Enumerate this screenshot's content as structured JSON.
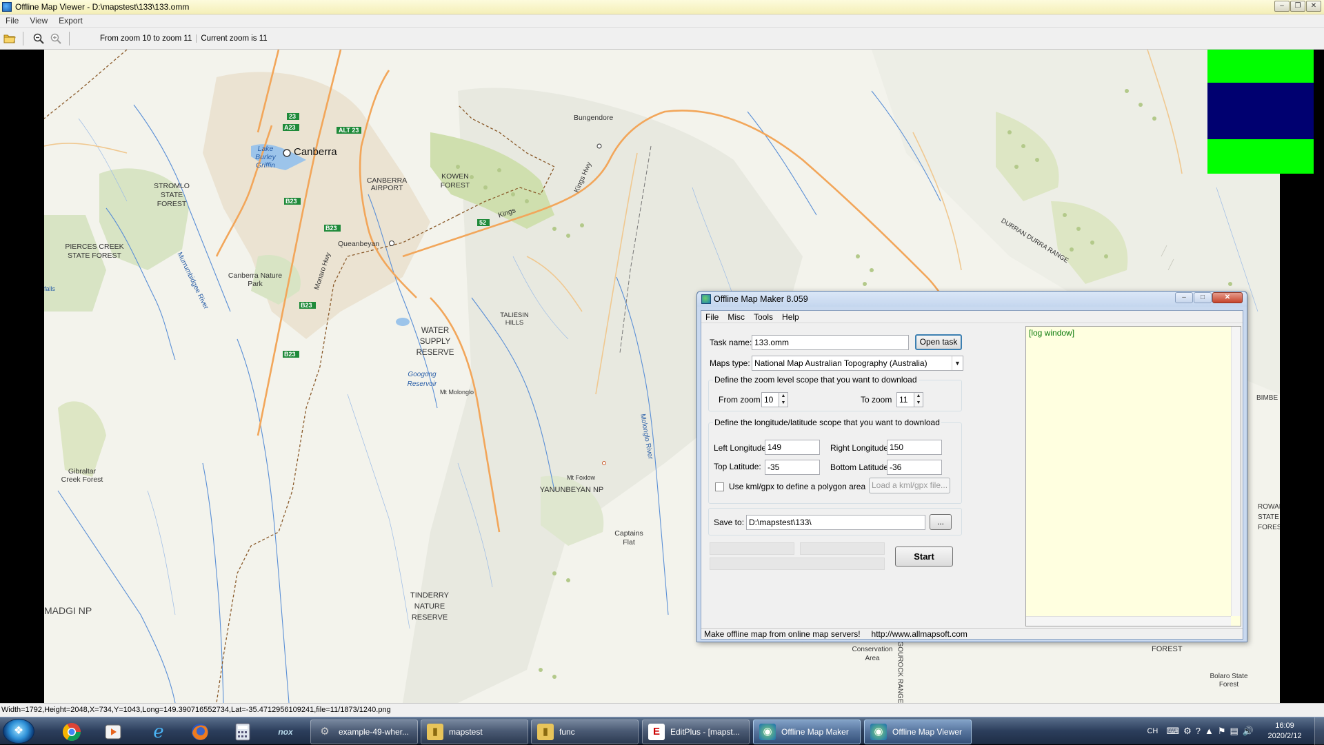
{
  "viewer": {
    "title": "Offline Map Viewer - D:\\mapstest\\133\\133.omm",
    "menu": [
      "File",
      "View",
      "Export"
    ],
    "toolbar": {
      "zoom_range": "From zoom 10 to zoom 11",
      "current_zoom": "Current zoom is 11"
    },
    "status": "Width=1792,Height=2048,X=734,Y=1043,Long=149.390716552734,Lat=-35.4712956109241,file=11/1873/1240.png"
  },
  "map": {
    "labels": [
      "Canberra",
      "CANBERRA AIRPORT",
      "Lake Burley Griffin",
      "STROMLO STATE FOREST",
      "PIERCES CREEK STATE FOREST",
      "Canberra Nature Park",
      "Queanbeyan",
      "Bungendore",
      "KOWEN FOREST",
      "Kings",
      "TALIESIN HILLS",
      "WATER SUPPLY RESERVE",
      "Googong Reservoir",
      "Mt Molonglo",
      "YANUNBEYAN NP",
      "Mt Foxlow",
      "Captains Flat",
      "TINDERRY NATURE RESERVE",
      "MADGI NP",
      "Gibraltar Creek Forest",
      "DURRAN DURRA RANGE",
      "Conservation Area",
      "FOREST",
      "Bolaro State Forest",
      "Monaro Hwy",
      "Kings Hwy",
      "Molonglo River",
      "Murrumbidgee River",
      "GOUROCK RANGE",
      "BIMBE",
      "ROWAN STATE FOREST",
      "falls"
    ],
    "road_shields": [
      "23",
      "A23",
      "ALT 23",
      "B23",
      "52"
    ],
    "colors": {
      "water": "#3b7fd4",
      "road_major": "#f2a65a",
      "road_minor": "#f0c890",
      "forest": "#d6e3bf",
      "park": "#ede3cf"
    }
  },
  "overview": {
    "colors": {
      "fill": "#00ff00",
      "band": "#000070"
    }
  },
  "dialog": {
    "title": "Offline Map Maker 8.059",
    "menu": [
      "File",
      "Misc",
      "Tools",
      "Help"
    ],
    "task_name_label": "Task name:",
    "task_name_value": "133.omm",
    "open_task_button": "Open task ...",
    "maps_type_label": "Maps type:",
    "maps_type_value": "National Map Australian Topography (Australia)",
    "zoom_group_label": "Define the zoom level scope that you want to download",
    "from_zoom_label": "From zoom",
    "from_zoom_value": "10",
    "to_zoom_label": "To zoom",
    "to_zoom_value": "11",
    "lonlat_group_label": "Define the longitude/latitude scope that you want to download",
    "left_lon_label": "Left Longitude:",
    "left_lon_value": "149",
    "right_lon_label": "Right Longitude:",
    "right_lon_value": "150",
    "top_lat_label": "Top Latitude:",
    "top_lat_value": "-35",
    "bottom_lat_label": "Bottom Latitude:",
    "bottom_lat_value": "-36",
    "kml_checkbox_label": "Use kml/gpx to define a polygon area",
    "kml_checked": false,
    "load_kml_button": "Load a kml/gpx file...",
    "save_to_label": "Save to:",
    "save_to_value": "D:\\mapstest\\133\\",
    "browse_button": "...",
    "start_button": "Start",
    "log_text": "[log window]",
    "status_left": "Make offline map from online map servers!",
    "status_right": "http://www.allmapsoft.com"
  },
  "taskbar": {
    "items": [
      {
        "label": "example-49-wher...",
        "icon": "tool-icon",
        "active": false
      },
      {
        "label": "mapstest",
        "icon": "folder-icon",
        "active": false
      },
      {
        "label": "func",
        "icon": "folder-icon",
        "active": false
      },
      {
        "label": "EditPlus - [mapst...",
        "icon": "editplus-icon",
        "active": false
      },
      {
        "label": "Offline Map Maker",
        "icon": "globe-icon",
        "active": true
      },
      {
        "label": "Offline Map Viewer",
        "icon": "globe-icon",
        "active": true
      }
    ],
    "tray_lang": "CH",
    "time": "16:09",
    "date": "2020/2/12"
  }
}
